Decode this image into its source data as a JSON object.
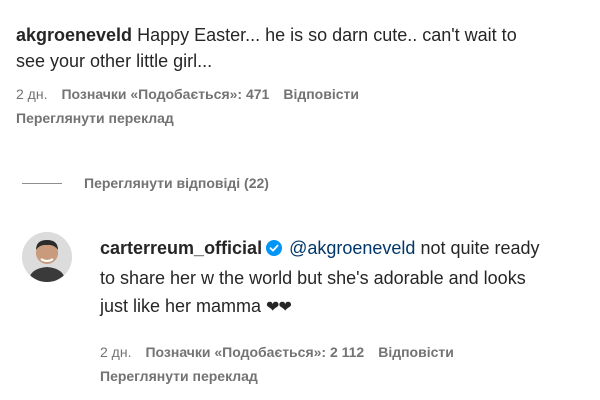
{
  "comment1": {
    "username": "akgroeneveld",
    "text_line1": " Happy Easter... he is so darn cute.. can't wait to",
    "text_line2": "see your other little girl...",
    "time": "2 дн.",
    "likes": "Позначки «Подобається»: 471",
    "reply_label": "Відповісти",
    "translate_label": "Переглянути переклад"
  },
  "replies_toggle": {
    "label": "Переглянути відповіді (22)"
  },
  "reply1": {
    "username": "carterreum_official",
    "mention": "@akgroeneveld",
    "text_line1_rest": " not quite ready",
    "text_line2": "to share her w the world but she's adorable and looks",
    "text_line3": "just like her mamma ",
    "hearts": "❤❤",
    "time": "2 дн.",
    "likes": "Позначки «Подобається»: 2 112",
    "reply_label": "Відповісти",
    "translate_label": "Переглянути переклад"
  },
  "colors": {
    "text": "#262626",
    "secondary": "#737373",
    "mention": "#00376b",
    "verified": "#0095f6"
  },
  "icons": [
    "verified-badge-icon"
  ]
}
